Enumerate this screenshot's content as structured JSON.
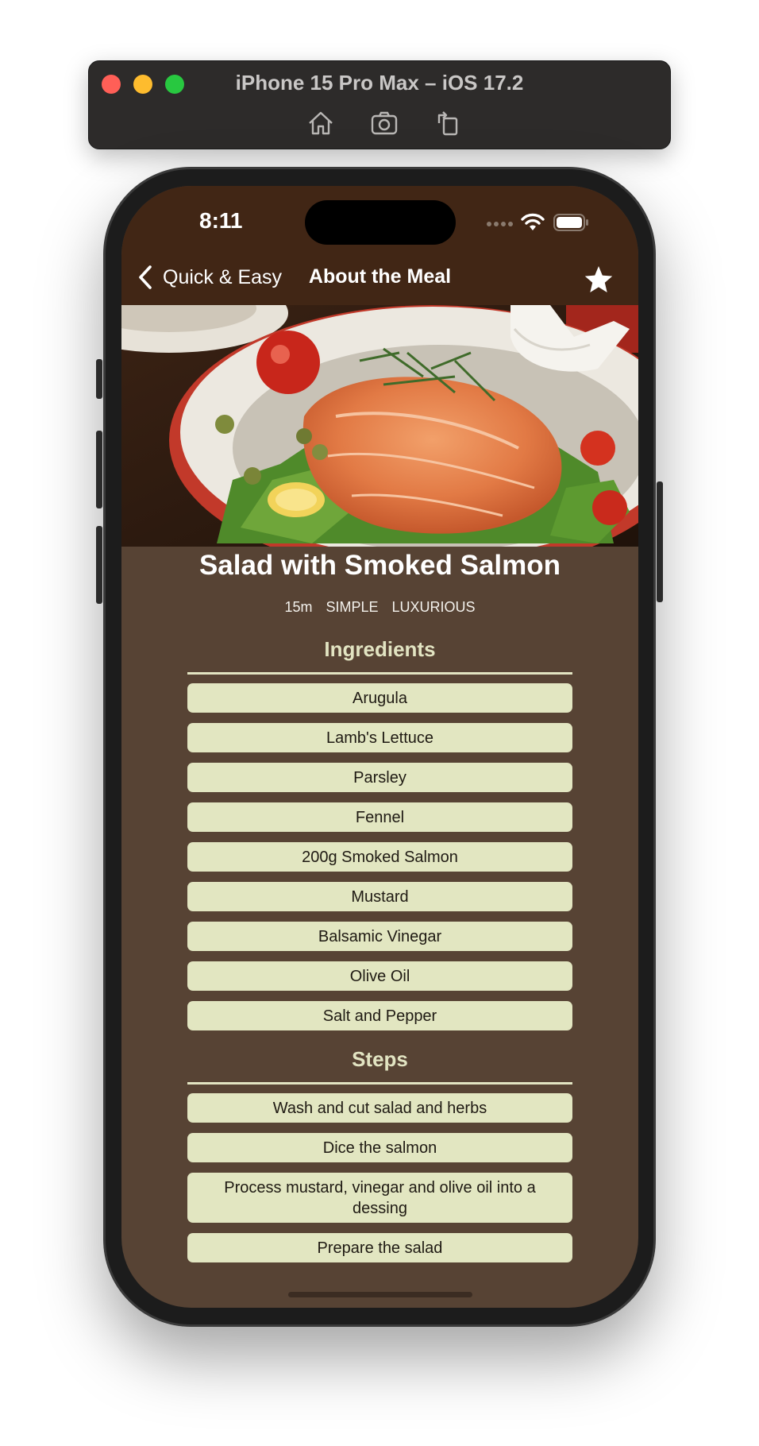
{
  "simulator": {
    "title": "iPhone 15 Pro Max – iOS 17.2",
    "tools": [
      "home-icon",
      "screenshot-icon",
      "rotate-icon"
    ]
  },
  "status_bar": {
    "time": "8:11"
  },
  "nav": {
    "back_label": "Quick & Easy",
    "title": "About the Meal",
    "favorite_icon": "star-icon"
  },
  "meal": {
    "title": "Salad with Smoked Salmon",
    "duration": "15m",
    "complexity": "SIMPLE",
    "affordability": "LUXURIOUS"
  },
  "ingredients": {
    "heading": "Ingredients",
    "items": [
      "Arugula",
      "Lamb's Lettuce",
      "Parsley",
      "Fennel",
      "200g Smoked Salmon",
      "Mustard",
      "Balsamic Vinegar",
      "Olive Oil",
      "Salt and Pepper"
    ]
  },
  "steps": {
    "heading": "Steps",
    "items": [
      "Wash and cut salad and herbs",
      "Dice the salmon",
      "Process mustard, vinegar and olive oil into a dessing",
      "Prepare the salad"
    ]
  },
  "colors": {
    "nav_background": "#412615",
    "page_background": "#574334",
    "pill_background": "#e2e6c1",
    "heading_color": "#e2e4c2"
  }
}
